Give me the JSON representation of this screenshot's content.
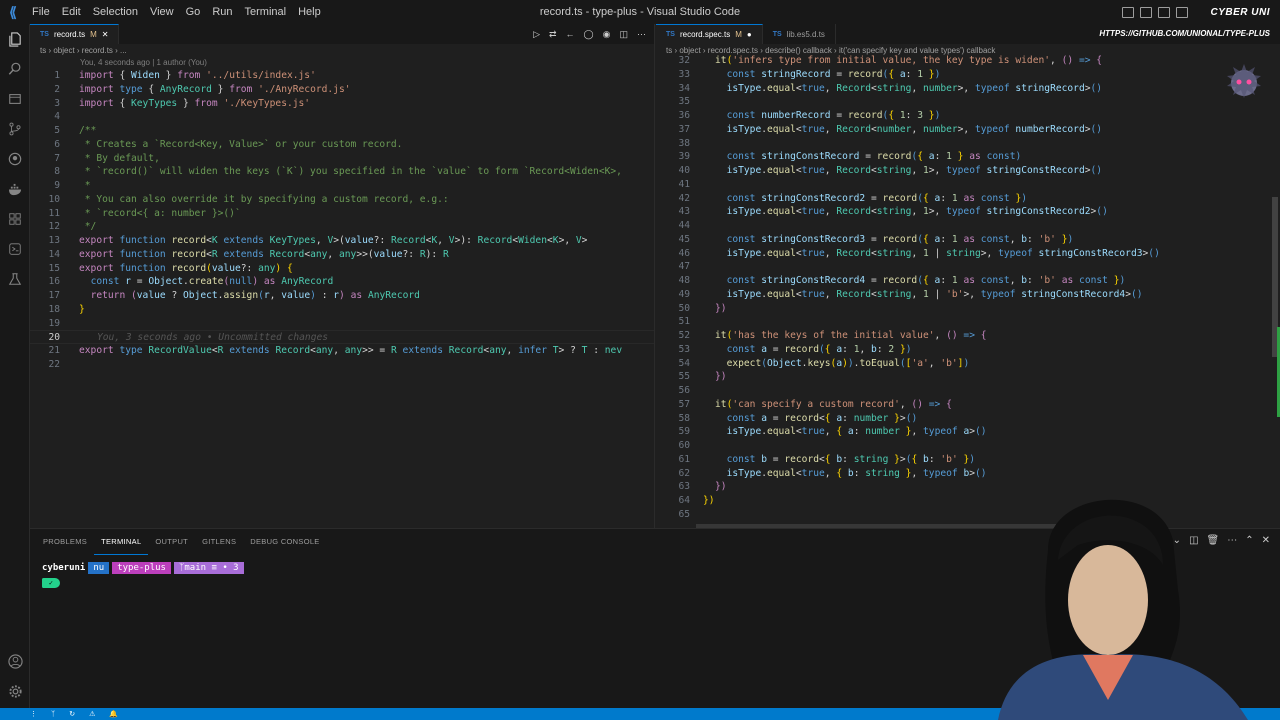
{
  "window": {
    "title": "record.ts - type-plus - Visual Studio Code",
    "menu": [
      "File",
      "Edit",
      "Selection",
      "View",
      "Go",
      "Run",
      "Terminal",
      "Help"
    ],
    "brand": "CYBER UNI",
    "brand_url": "HTTPS://GITHUB.COM/UNIONAL/TYPE-PLUS"
  },
  "left_editor": {
    "tab": {
      "label": "record.ts",
      "status": "M"
    },
    "breadcrumb": "ts › object › record.ts › ...",
    "blame": "You, 4 seconds ago | 1 author (You)",
    "inline_blame": "You, 3 seconds ago • Uncommitted changes",
    "current_line": 20
  },
  "right_editor": {
    "tabs": [
      {
        "label": "record.spec.ts",
        "status": "M"
      },
      {
        "label": "lib.es5.d.ts",
        "status": ""
      }
    ],
    "breadcrumb": "ts › object › record.spec.ts › describe() callback › it('can specify key and value types') callback"
  },
  "panel": {
    "tabs": [
      "PROBLEMS",
      "TERMINAL",
      "OUTPUT",
      "GITLENS",
      "DEBUG CONSOLE"
    ],
    "active_tab": "TERMINAL",
    "prompt": {
      "user": "cyberuni",
      "shell": "nu",
      "dir": "type-plus",
      "branch": "main",
      "git_status": "≡ • 3"
    },
    "shell_label": "nu"
  },
  "icons": {
    "activity": [
      "files-icon",
      "search-icon",
      "explorer-alt-icon",
      "source-control-icon",
      "github-icon",
      "docker-icon",
      "extensions-icon",
      "remote-icon",
      "testing-icon",
      "account-icon",
      "settings-gear-icon"
    ]
  },
  "colors": {
    "accent": "#0078d4",
    "status_bar": "#007acc",
    "keyword": "#569cd6",
    "control": "#c586c0",
    "function": "#dcdcaa",
    "type": "#4ec9b0",
    "string": "#ce9178",
    "comment": "#6a9955"
  }
}
